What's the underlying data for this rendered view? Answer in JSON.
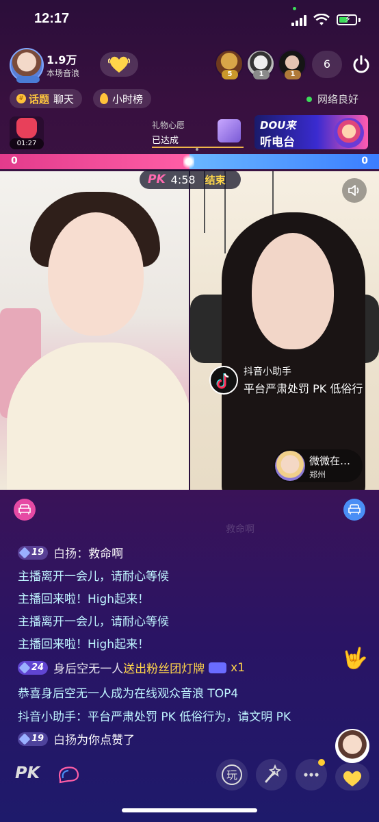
{
  "status_bar": {
    "time": "12:17"
  },
  "host": {
    "popularity": "1.9万",
    "popularity_label": "本场音浪"
  },
  "top_viewers": [
    {
      "rank": "5",
      "color": "#c9982a"
    },
    {
      "rank": "1",
      "color": "#b0b0b0"
    },
    {
      "rank": "1",
      "color": "#c98a3a"
    }
  ],
  "viewer_count": "6",
  "chips": {
    "topic_highlight": "话题",
    "topic_label": "聊天",
    "hour_rank": "小时榜",
    "network": "网络良好"
  },
  "gift_timer": "01:27",
  "wish": {
    "title": "礼物心愿",
    "status": "已达成"
  },
  "banner": {
    "line1": "DOU来",
    "line2": "听电台"
  },
  "pk": {
    "score_left": "0",
    "score_right": "0",
    "logo": "PK",
    "time_left": "4:58",
    "end_label": "结束",
    "left_color": "#e23b8c",
    "right_color": "#3a7dff"
  },
  "notice": {
    "sender": "抖音小助手",
    "text": "平台严肃处罚 PK 低俗行"
  },
  "guest": {
    "name": "微微在…",
    "location": "郑州"
  },
  "chat": {
    "faded": "救命啊",
    "lines": [
      {
        "level": "19",
        "name": "白扬：",
        "msg": "救命啊"
      },
      {
        "sys": "主播离开一会儿，请耐心等候"
      },
      {
        "sys": "主播回来啦！High起来！"
      },
      {
        "sys": "主播离开一会儿，请耐心等候"
      },
      {
        "sys": "主播回来啦！High起来！"
      },
      {
        "level": "24",
        "name": "身后空无一人",
        "msg": " 送出粉丝团灯牌",
        "suffix": "x1"
      },
      {
        "sys": "恭喜身后空无一人成为在线观众音浪 TOP4"
      },
      {
        "sys": "抖音小助手：平台严肃处罚 PK 低俗行为，请文明 PK"
      },
      {
        "level": "19",
        "name": "白扬",
        "msg": " 为你点赞了"
      }
    ]
  },
  "bottom": {
    "pk_label": "PK",
    "play_label": "玩"
  },
  "icons": [
    "heart-icon",
    "power-icon",
    "speaker-icon",
    "seat-icon",
    "chat-icon",
    "wand-icon",
    "more-icon",
    "gift-icon"
  ]
}
